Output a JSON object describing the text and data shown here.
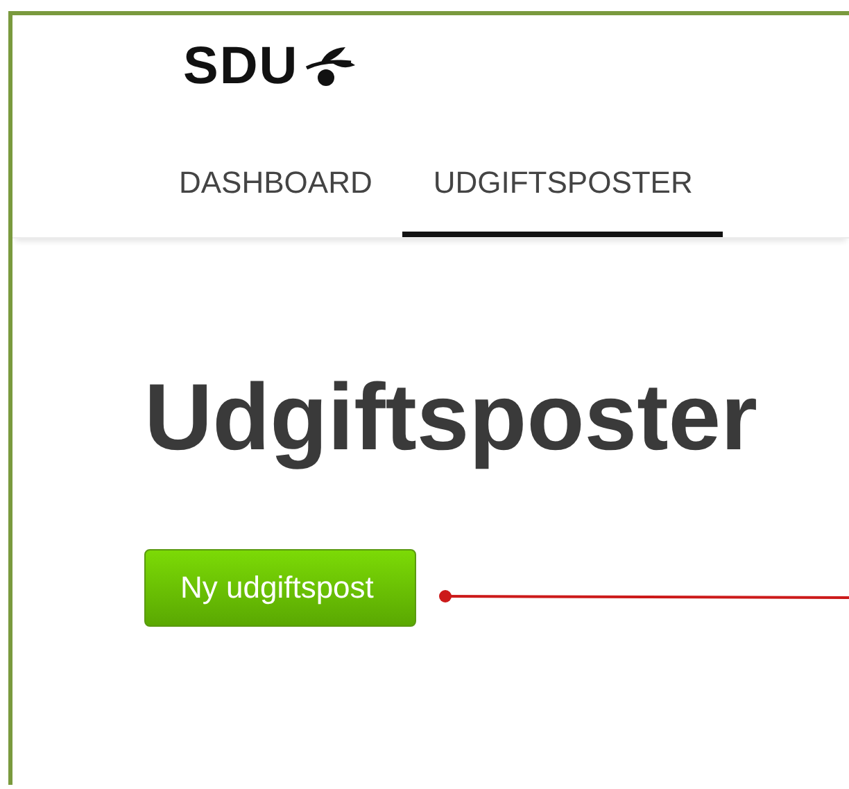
{
  "logo": {
    "text": "SDU"
  },
  "tabs": [
    {
      "label": "DASHBOARD",
      "selected": false
    },
    {
      "label": "UDGIFTSPOSTER",
      "selected": true
    }
  ],
  "heading": "Udgiftsposter",
  "new_button": {
    "label": "Ny udgiftspost"
  }
}
